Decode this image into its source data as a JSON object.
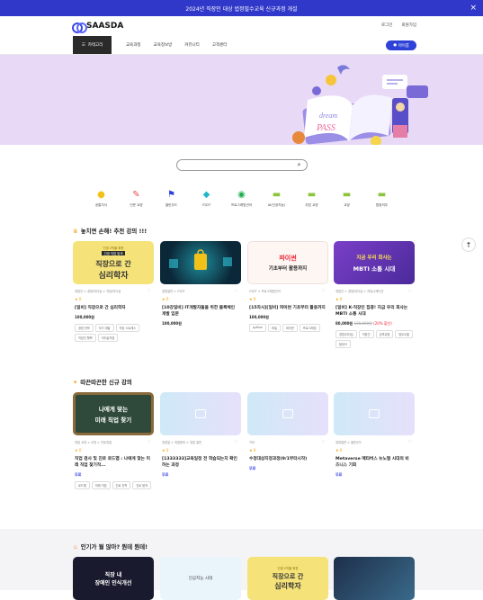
{
  "banner": {
    "text": "2024년 직장인 대상 법정필수교육 신규과정 개설",
    "close": "×"
  },
  "header": {
    "logo": "SAASDA",
    "login": "로그인",
    "signup": "회원가입"
  },
  "nav": {
    "category": "카테고리",
    "items": [
      "교육과정",
      "교육정보방",
      "커뮤니티",
      "고객센터"
    ],
    "my": "마이룸"
  },
  "hero": {
    "book_text_1": "dream",
    "book_text_2": "PASS"
  },
  "search": {
    "placeholder": ""
  },
  "categories": [
    {
      "label": "공통지식",
      "icon": "lightbulb-icon",
      "color": "#f2c21a"
    },
    {
      "label": "인문 교양",
      "icon": "pencil-icon",
      "color": "#e94d4d"
    },
    {
      "label": "클린우드",
      "icon": "flag-icon",
      "color": "#2f42d8"
    },
    {
      "label": "IT/DT",
      "icon": "tag-icon",
      "color": "#1fb7c9"
    },
    {
      "label": "프로그래밍언어",
      "icon": "record-icon",
      "color": "#1fae4f"
    },
    {
      "label": "AI(인공지능)",
      "icon": "chat-icon",
      "color": "#8bc53f"
    },
    {
      "label": "취업 교양",
      "icon": "chat-icon",
      "color": "#8bc53f"
    },
    {
      "label": "교양",
      "icon": "chat-icon",
      "color": "#8bc53f"
    },
    {
      "label": "법정의무",
      "icon": "chat-icon",
      "color": "#8bc53f"
    }
  ],
  "section1": {
    "title": "놓치면 손해! 추천 강의 !!!",
    "cards": [
      {
        "thumb_line1": "인생 2막을 위한",
        "thumb_line2": "인생 직업 탐색",
        "thumb_main1": "직장으로 간",
        "thumb_main2": "심리학자",
        "meta": "취업인 > 경영/리더십 > 직장/리더십",
        "stars": "★ 0",
        "title": "[일비] 직장으로 간 심리학자",
        "price": "100,000원",
        "tags": [
          "경영 전략",
          "자기 계발",
          "직장 스트레스",
          "직장인 행복",
          "리더십직장"
        ]
      },
      {
        "meta": "경영일반 > IT/DT",
        "stars": "★ 0",
        "title": "[10강일비] IT개발자들을 위한 블록체인 개발 입문",
        "price": "100,000원",
        "tags": []
      },
      {
        "thumb_main1": "파이썬",
        "thumb_main2": "기초부터 활용까지",
        "meta": "IT/DT > 프로그래밍언어",
        "stars": "★ 0",
        "title": "[15차시][일비] 파이썬 기초부터 활용까지",
        "price": "100,000원",
        "tags": [
          "python",
          "파일",
          "파이썬",
          "프로그래밍"
        ]
      },
      {
        "thumb_line1": "지금 우리 회사는",
        "thumb_main2": "MBTI 소통 시대",
        "meta": "취업인 > 경영/리더십 > 커뮤니케이션",
        "stars": "★ 0",
        "title": "[일비] K-직장인 집중! 지금 우리 회사는 MBTI 소통 시대",
        "price": "80,000원",
        "old": "100,000원",
        "disc": "(20% 할인)",
        "tags": [
          "경영/리더십",
          "직장인",
          "성격유형",
          "업무소통",
          "팀워크"
        ]
      }
    ]
  },
  "section2": {
    "title": "따끈따끈한 신규 강의",
    "cards": [
      {
        "thumb_main1": "나에게 맞는",
        "thumb_main2": "미래 직업 찾기",
        "meta": "취업 교양 > 교양 > 진로취업",
        "stars": "★ 0",
        "title": "직업 검사 및 진로 로드맵 : 나에게 맞는 미래 직업 찾기작...",
        "free": "무료",
        "tags": [
          "로드맵",
          "미래 직업",
          "진로 진학",
          "진로 탐색"
        ]
      },
      {
        "meta": "취업일 > 취업준비 > 취업 일반",
        "stars": "★ 0",
        "title": "[1333333]교육일정 전 학습되는지 확인하는 과정",
        "free": "무료",
        "tags": []
      },
      {
        "meta": "기타",
        "stars": "★ 0",
        "title": "수정대상지정과정(9/1부터시작)",
        "free": "무료",
        "tags": []
      },
      {
        "meta": "경영일반 > 클린우드",
        "stars": "★ 0",
        "title": "Metaverse 메타버스 뉴노멀 시대의 비즈니스 기회",
        "free": "무료",
        "tags": []
      }
    ]
  },
  "section3": {
    "title": "인기가 뭘 많아? 뭔데 뭔데!",
    "cards": [
      {
        "thumb_main1": "직장 내",
        "thumb_main2": "장애인 인식개선"
      },
      {
        "thumb_main1": "인공지능 시대"
      },
      {
        "thumb_line1": "인생 2막을 위한",
        "thumb_main1": "직장으로 간",
        "thumb_main2": "심리학자"
      },
      {
        "thumb_main1": ""
      }
    ]
  }
}
